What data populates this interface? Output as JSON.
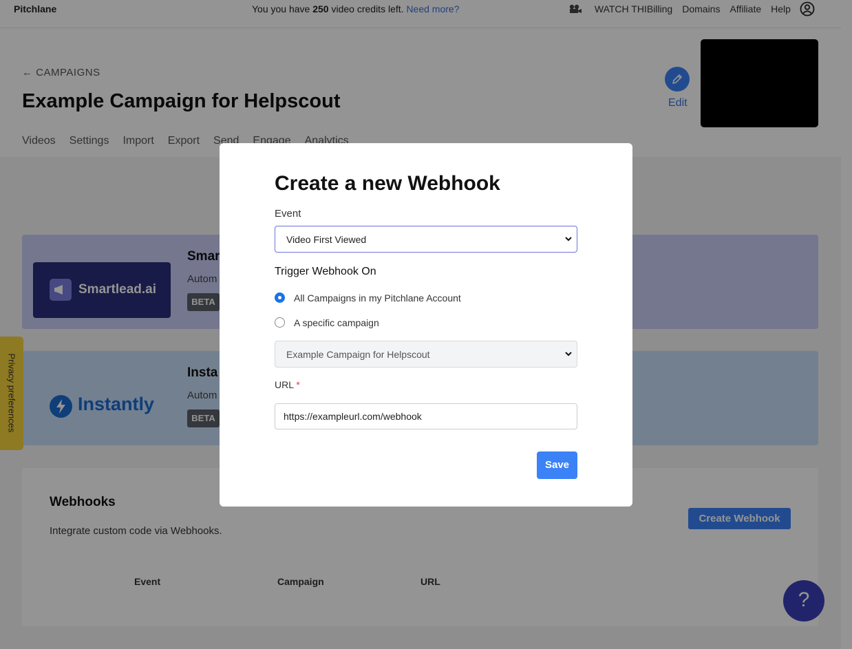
{
  "topbar": {
    "brand": "Pitchlane",
    "credits_prefix": "You you have ",
    "credits_count": "250",
    "credits_suffix": " video credits left. ",
    "need_more": "Need more?",
    "watch": "WATCH THI",
    "billing": "Billing",
    "domains": "Domains",
    "affiliate": "Affiliate",
    "help": "Help"
  },
  "header": {
    "back": "CAMPAIGNS",
    "title": "Example Campaign for Helpscout",
    "edit": "Edit"
  },
  "tabs": [
    "Videos",
    "Settings",
    "Import",
    "Export",
    "Send",
    "Engage",
    "Analytics"
  ],
  "integrations": {
    "smartlead": {
      "logo_text": "Smartlead.ai",
      "title": "Smar",
      "sub": "Autom",
      "badge": "BETA"
    },
    "instantly": {
      "logo_text": "Instantly",
      "title": "Insta",
      "sub": "Autom",
      "badge": "BETA"
    }
  },
  "webhooks": {
    "title": "Webhooks",
    "sub": "Integrate custom code via Webhooks.",
    "create": "Create Webhook",
    "columns": [
      "Event",
      "Campaign",
      "URL"
    ]
  },
  "privacy": "Privacy preferences",
  "help_bubble": "?",
  "modal": {
    "title": "Create a new Webhook",
    "event_label": "Event",
    "event_value": "Video First Viewed",
    "trigger_label": "Trigger Webhook On",
    "options": [
      "All Campaigns in my Pitchlane Account",
      "A specific campaign"
    ],
    "selected_option": 0,
    "campaign_value": "Example Campaign for Helpscout",
    "url_label": "URL",
    "url_required": "*",
    "url_value": "https://exampleurl.com/webhook",
    "save": "Save"
  },
  "colors": {
    "accent": "#3b82f6",
    "smartlead_card": "#c9cdf5",
    "instantly_card": "#c6dcf8",
    "privacy_tab": "#f5d33c",
    "help_bubble": "#3b3fb9"
  }
}
